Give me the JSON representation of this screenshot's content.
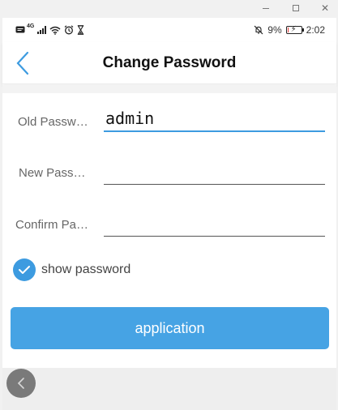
{
  "window": {
    "min_icon": "minimize-icon",
    "max_icon": "maximize-icon",
    "close_icon": "close-icon",
    "close_glyph": "✕"
  },
  "status_bar": {
    "network_label": "4G",
    "battery_percent": "9%",
    "battery_level": 0.09,
    "time": "2:02",
    "battery_color": "#e53935"
  },
  "header": {
    "title": "Change Password",
    "back_icon": "chevron-left-icon"
  },
  "form": {
    "old_password": {
      "label": "Old Password",
      "value": "admin"
    },
    "new_password": {
      "label": "New Password",
      "value": ""
    },
    "confirm_password": {
      "label": "Confirm Password",
      "value": ""
    },
    "show_password": {
      "label": "show password",
      "checked": true
    }
  },
  "apply_button": {
    "label": "application"
  },
  "colors": {
    "accent": "#3d9be0",
    "button": "#46a3e4",
    "float_button": "#7a7a7a"
  }
}
